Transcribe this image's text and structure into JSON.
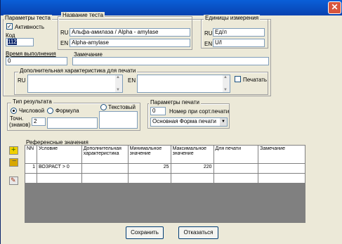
{
  "window": {
    "close_glyph": "✕"
  },
  "test_params": {
    "legend": "Параметры теста",
    "active_label": "Активность",
    "active_checked": true,
    "code_label": "Код",
    "code_value": "112",
    "name_legend": "Название теста",
    "name_ru_label": "RU",
    "name_ru": "Альфа-амилаза / Alpha - amylase",
    "name_en_label": "EN",
    "name_en": "Alpha-amylase",
    "units_legend": "Единицы измерения",
    "units_ru_label": "RU",
    "units_ru": "Ед/л",
    "units_en_label": "EN",
    "units_en": "U/l",
    "time_label": "Время выполнения",
    "time_value": "0",
    "note_label": "Замечание",
    "note_value": "",
    "print_char_legend": "Дополнительная характеристика для печати",
    "print_ru_label": "RU",
    "print_en_label": "EN",
    "print_checkbox_label": "Печатать",
    "print_checked": false
  },
  "result_type": {
    "legend": "Тип результата",
    "numeric_label": "Числовой",
    "formula_label": "Формула",
    "text_label": "Текстовый",
    "selected": "numeric",
    "precision_label_1": "Точн.",
    "precision_label_2": "(знаков)",
    "precision_value": "2"
  },
  "print_params": {
    "legend": "Параметры печати",
    "sort_value": "0",
    "sort_label": "Номер при сорт.печати",
    "form_value": "Основная Форма печати"
  },
  "reference": {
    "label": "Референсные значения",
    "columns": [
      "NN",
      "Условие",
      "Дополнительная характеристика",
      "Минимальное значение",
      "Максимальное значение",
      "Для печати",
      "Замечание"
    ],
    "rows": [
      [
        "1",
        "ВОЗРАСТ > 0",
        "",
        "25",
        "220",
        "",
        ""
      ],
      [
        "",
        "",
        "",
        "",
        "",
        "",
        ""
      ]
    ],
    "tool_colors": {
      "add": "#f0d000",
      "remove": "#d8a800"
    }
  },
  "buttons": {
    "save": "Сохранить",
    "cancel": "Отказаться"
  }
}
